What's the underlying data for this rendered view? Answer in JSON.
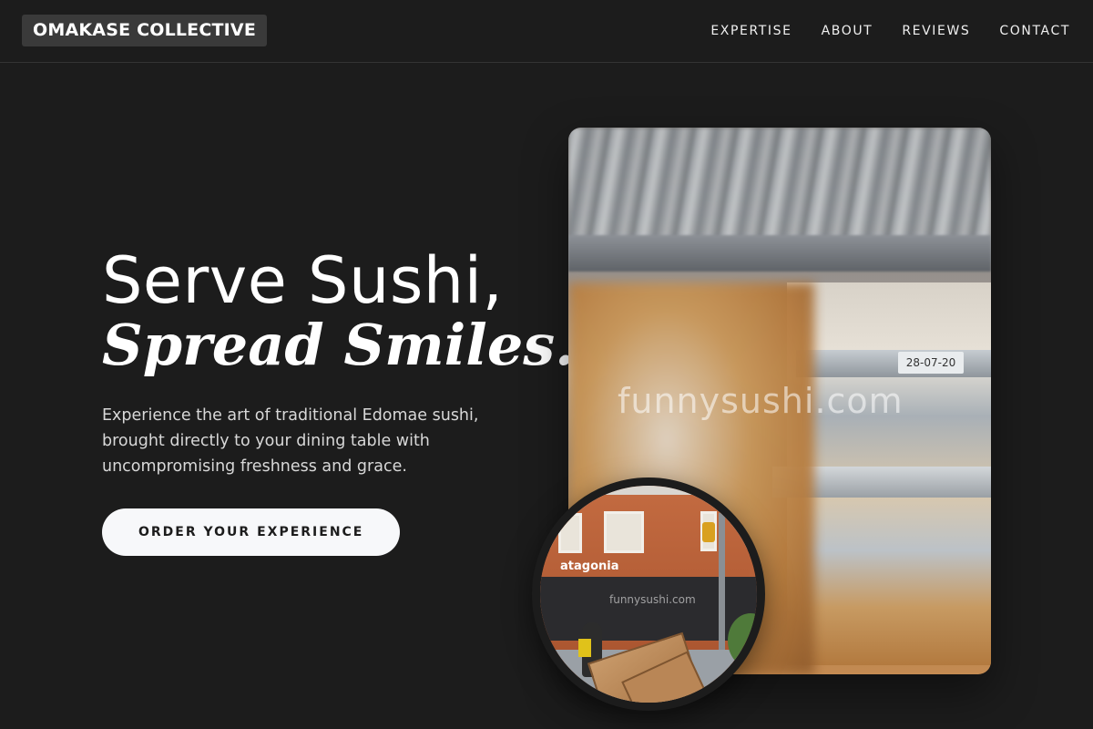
{
  "header": {
    "logo": "OMAKASE COLLECTIVE",
    "nav": [
      "EXPERTISE",
      "ABOUT",
      "REVIEWS",
      "CONTACT"
    ]
  },
  "hero": {
    "title_line1": "Serve Sushi,",
    "title_line2": "Spread Smiles.",
    "lede": "Experience the art of traditional Edomae sushi, brought directly to your dining table with uncompromising freshness and grace.",
    "cta": "ORDER YOUR EXPERIENCE"
  },
  "images": {
    "main": {
      "watermark": "funnysushi.com",
      "date_tag": "28-07-20"
    },
    "circle": {
      "storefront_sign": "atagonia",
      "watermark": "funnysushi.com"
    }
  },
  "colors": {
    "background": "#1c1c1c",
    "cta_bg": "#f7f8fa",
    "logo_bg": "#3a3a3a"
  }
}
